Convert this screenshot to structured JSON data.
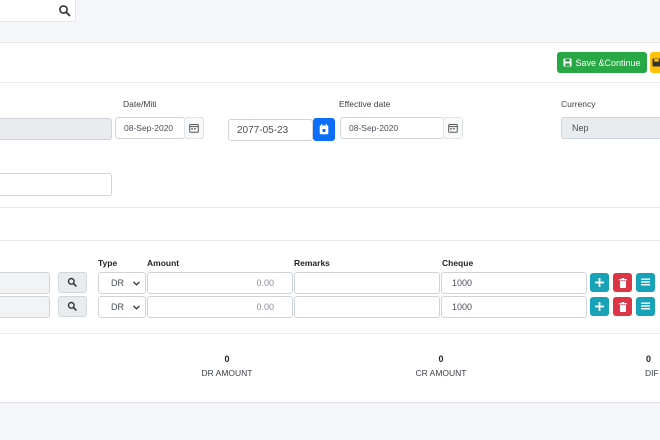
{
  "topbar": {
    "search_icon": "search-icon"
  },
  "toolbar": {
    "save_continue_label": "Save &Continue"
  },
  "form": {
    "date_label": "Date/Miti",
    "date_value": "08-Sep-2020",
    "nepali_date_value": "2077-05-23",
    "effective_date_label": "Effective date",
    "effective_date_value": "08-Sep-2020",
    "currency_label": "Currency",
    "currency_value": "Nep"
  },
  "table": {
    "headers": {
      "type": "Type",
      "amount": "Amount",
      "remarks": "Remarks",
      "cheque": "Cheque"
    },
    "rows": [
      {
        "type": "DR",
        "amount": "0.00",
        "remarks": "",
        "cheque": "1000"
      },
      {
        "type": "DR",
        "amount": "0.00",
        "remarks": "",
        "cheque": "1000"
      }
    ]
  },
  "totals": {
    "dr_value": "0",
    "dr_label": "DR AMOUNT",
    "cr_value": "0",
    "cr_label": "CR AMOUNT",
    "diff_value": "0",
    "diff_label": "DIF"
  },
  "colors": {
    "primary": "#0d6efd",
    "success": "#28a745",
    "info": "#17a2b8",
    "danger": "#dc3545",
    "warning": "#ffc107"
  }
}
